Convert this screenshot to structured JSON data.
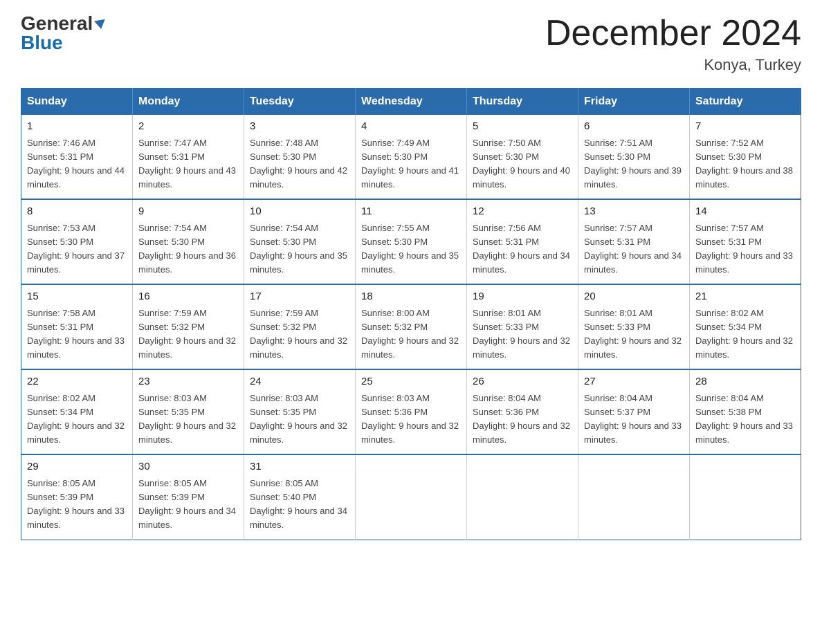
{
  "logo": {
    "general": "General",
    "blue": "Blue"
  },
  "title": "December 2024",
  "subtitle": "Konya, Turkey",
  "days_of_week": [
    "Sunday",
    "Monday",
    "Tuesday",
    "Wednesday",
    "Thursday",
    "Friday",
    "Saturday"
  ],
  "weeks": [
    [
      {
        "day": "1",
        "sunrise": "7:46 AM",
        "sunset": "5:31 PM",
        "daylight": "9 hours and 44 minutes."
      },
      {
        "day": "2",
        "sunrise": "7:47 AM",
        "sunset": "5:31 PM",
        "daylight": "9 hours and 43 minutes."
      },
      {
        "day": "3",
        "sunrise": "7:48 AM",
        "sunset": "5:30 PM",
        "daylight": "9 hours and 42 minutes."
      },
      {
        "day": "4",
        "sunrise": "7:49 AM",
        "sunset": "5:30 PM",
        "daylight": "9 hours and 41 minutes."
      },
      {
        "day": "5",
        "sunrise": "7:50 AM",
        "sunset": "5:30 PM",
        "daylight": "9 hours and 40 minutes."
      },
      {
        "day": "6",
        "sunrise": "7:51 AM",
        "sunset": "5:30 PM",
        "daylight": "9 hours and 39 minutes."
      },
      {
        "day": "7",
        "sunrise": "7:52 AM",
        "sunset": "5:30 PM",
        "daylight": "9 hours and 38 minutes."
      }
    ],
    [
      {
        "day": "8",
        "sunrise": "7:53 AM",
        "sunset": "5:30 PM",
        "daylight": "9 hours and 37 minutes."
      },
      {
        "day": "9",
        "sunrise": "7:54 AM",
        "sunset": "5:30 PM",
        "daylight": "9 hours and 36 minutes."
      },
      {
        "day": "10",
        "sunrise": "7:54 AM",
        "sunset": "5:30 PM",
        "daylight": "9 hours and 35 minutes."
      },
      {
        "day": "11",
        "sunrise": "7:55 AM",
        "sunset": "5:30 PM",
        "daylight": "9 hours and 35 minutes."
      },
      {
        "day": "12",
        "sunrise": "7:56 AM",
        "sunset": "5:31 PM",
        "daylight": "9 hours and 34 minutes."
      },
      {
        "day": "13",
        "sunrise": "7:57 AM",
        "sunset": "5:31 PM",
        "daylight": "9 hours and 34 minutes."
      },
      {
        "day": "14",
        "sunrise": "7:57 AM",
        "sunset": "5:31 PM",
        "daylight": "9 hours and 33 minutes."
      }
    ],
    [
      {
        "day": "15",
        "sunrise": "7:58 AM",
        "sunset": "5:31 PM",
        "daylight": "9 hours and 33 minutes."
      },
      {
        "day": "16",
        "sunrise": "7:59 AM",
        "sunset": "5:32 PM",
        "daylight": "9 hours and 32 minutes."
      },
      {
        "day": "17",
        "sunrise": "7:59 AM",
        "sunset": "5:32 PM",
        "daylight": "9 hours and 32 minutes."
      },
      {
        "day": "18",
        "sunrise": "8:00 AM",
        "sunset": "5:32 PM",
        "daylight": "9 hours and 32 minutes."
      },
      {
        "day": "19",
        "sunrise": "8:01 AM",
        "sunset": "5:33 PM",
        "daylight": "9 hours and 32 minutes."
      },
      {
        "day": "20",
        "sunrise": "8:01 AM",
        "sunset": "5:33 PM",
        "daylight": "9 hours and 32 minutes."
      },
      {
        "day": "21",
        "sunrise": "8:02 AM",
        "sunset": "5:34 PM",
        "daylight": "9 hours and 32 minutes."
      }
    ],
    [
      {
        "day": "22",
        "sunrise": "8:02 AM",
        "sunset": "5:34 PM",
        "daylight": "9 hours and 32 minutes."
      },
      {
        "day": "23",
        "sunrise": "8:03 AM",
        "sunset": "5:35 PM",
        "daylight": "9 hours and 32 minutes."
      },
      {
        "day": "24",
        "sunrise": "8:03 AM",
        "sunset": "5:35 PM",
        "daylight": "9 hours and 32 minutes."
      },
      {
        "day": "25",
        "sunrise": "8:03 AM",
        "sunset": "5:36 PM",
        "daylight": "9 hours and 32 minutes."
      },
      {
        "day": "26",
        "sunrise": "8:04 AM",
        "sunset": "5:36 PM",
        "daylight": "9 hours and 32 minutes."
      },
      {
        "day": "27",
        "sunrise": "8:04 AM",
        "sunset": "5:37 PM",
        "daylight": "9 hours and 33 minutes."
      },
      {
        "day": "28",
        "sunrise": "8:04 AM",
        "sunset": "5:38 PM",
        "daylight": "9 hours and 33 minutes."
      }
    ],
    [
      {
        "day": "29",
        "sunrise": "8:05 AM",
        "sunset": "5:39 PM",
        "daylight": "9 hours and 33 minutes."
      },
      {
        "day": "30",
        "sunrise": "8:05 AM",
        "sunset": "5:39 PM",
        "daylight": "9 hours and 34 minutes."
      },
      {
        "day": "31",
        "sunrise": "8:05 AM",
        "sunset": "5:40 PM",
        "daylight": "9 hours and 34 minutes."
      },
      null,
      null,
      null,
      null
    ]
  ]
}
